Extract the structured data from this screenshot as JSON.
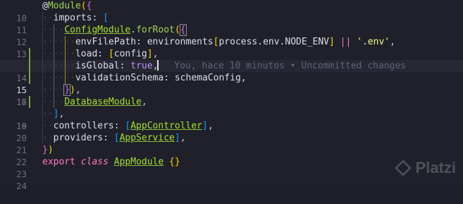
{
  "editor": {
    "lines": [
      {
        "number": "10",
        "tokens": [
          [
            "b0",
            "@"
          ],
          [
            "fn",
            "Module"
          ],
          [
            "b1",
            "("
          ],
          [
            "b2",
            "{"
          ]
        ]
      },
      {
        "number": "11",
        "tokens": [
          [
            "plain",
            "imports: "
          ],
          [
            "b3",
            "["
          ]
        ]
      },
      {
        "number": "12",
        "tokens": [
          [
            "cls",
            "ConfigModule"
          ],
          [
            "punct",
            "."
          ],
          [
            "fn",
            "forRoot"
          ],
          [
            "b1",
            "("
          ],
          [
            "b2",
            "{"
          ]
        ]
      },
      {
        "number": "13",
        "tokens": [
          [
            "plain",
            "envFilePath: environments"
          ],
          [
            "b1",
            "["
          ],
          [
            "plain",
            "process.env.NODE_ENV"
          ],
          [
            "b1",
            "]"
          ],
          [
            "plain",
            " "
          ],
          [
            "op",
            "||"
          ],
          [
            "plain",
            " "
          ],
          [
            "str",
            "'.env'"
          ],
          [
            "punct",
            ","
          ]
        ]
      },
      {
        "number": "14",
        "tokens": [
          [
            "plain",
            "load: "
          ],
          [
            "b1",
            "["
          ],
          [
            "plain",
            "config"
          ],
          [
            "b1",
            "]"
          ],
          [
            "punct",
            ","
          ]
        ]
      },
      {
        "number": "15",
        "tokens": [
          [
            "plain",
            "isGlobal: "
          ],
          [
            "bool",
            "true"
          ],
          [
            "punct",
            ","
          ]
        ]
      },
      {
        "number": "16",
        "tokens": [
          [
            "plain",
            "validationSchema: schemaConfig,"
          ]
        ]
      },
      {
        "number": "17",
        "tokens": [
          [
            "b2",
            "}"
          ],
          [
            "b1",
            ")"
          ],
          [
            "punct",
            ","
          ]
        ]
      },
      {
        "number": "18",
        "tokens": [
          [
            "cls",
            "DatabaseModule"
          ],
          [
            "punct",
            ","
          ]
        ]
      },
      {
        "number": "19",
        "tokens": [
          [
            "b3",
            "]"
          ],
          [
            "punct",
            ","
          ]
        ]
      },
      {
        "number": "20",
        "tokens": [
          [
            "plain",
            "controllers: "
          ],
          [
            "b3",
            "["
          ],
          [
            "cls",
            "AppController"
          ],
          [
            "b3",
            "]"
          ],
          [
            "punct",
            ","
          ]
        ]
      },
      {
        "number": "21",
        "tokens": [
          [
            "plain",
            "providers: "
          ],
          [
            "b3",
            "["
          ],
          [
            "cls",
            "AppService"
          ],
          [
            "b3",
            "]"
          ],
          [
            "punct",
            ","
          ]
        ]
      },
      {
        "number": "22",
        "tokens": [
          [
            "b2",
            "}"
          ],
          [
            "b1",
            ")"
          ]
        ]
      },
      {
        "number": "23",
        "tokens": [
          [
            "kwn",
            "export"
          ],
          [
            "plain",
            " "
          ],
          [
            "kw",
            "class"
          ],
          [
            "plain",
            " "
          ],
          [
            "cls",
            "AppModule"
          ],
          [
            "plain",
            " "
          ],
          [
            "b1",
            "{}"
          ]
        ]
      },
      {
        "number": "24",
        "tokens": []
      }
    ],
    "blame_text": "You, hace 10 minutos • Uncommitted changes",
    "current_line": "15"
  },
  "watermark": {
    "brand": "Platzi"
  },
  "colors": {
    "background": "#1f2029",
    "gutter": "#6b6f82",
    "modified_bar": "#7aa843"
  }
}
